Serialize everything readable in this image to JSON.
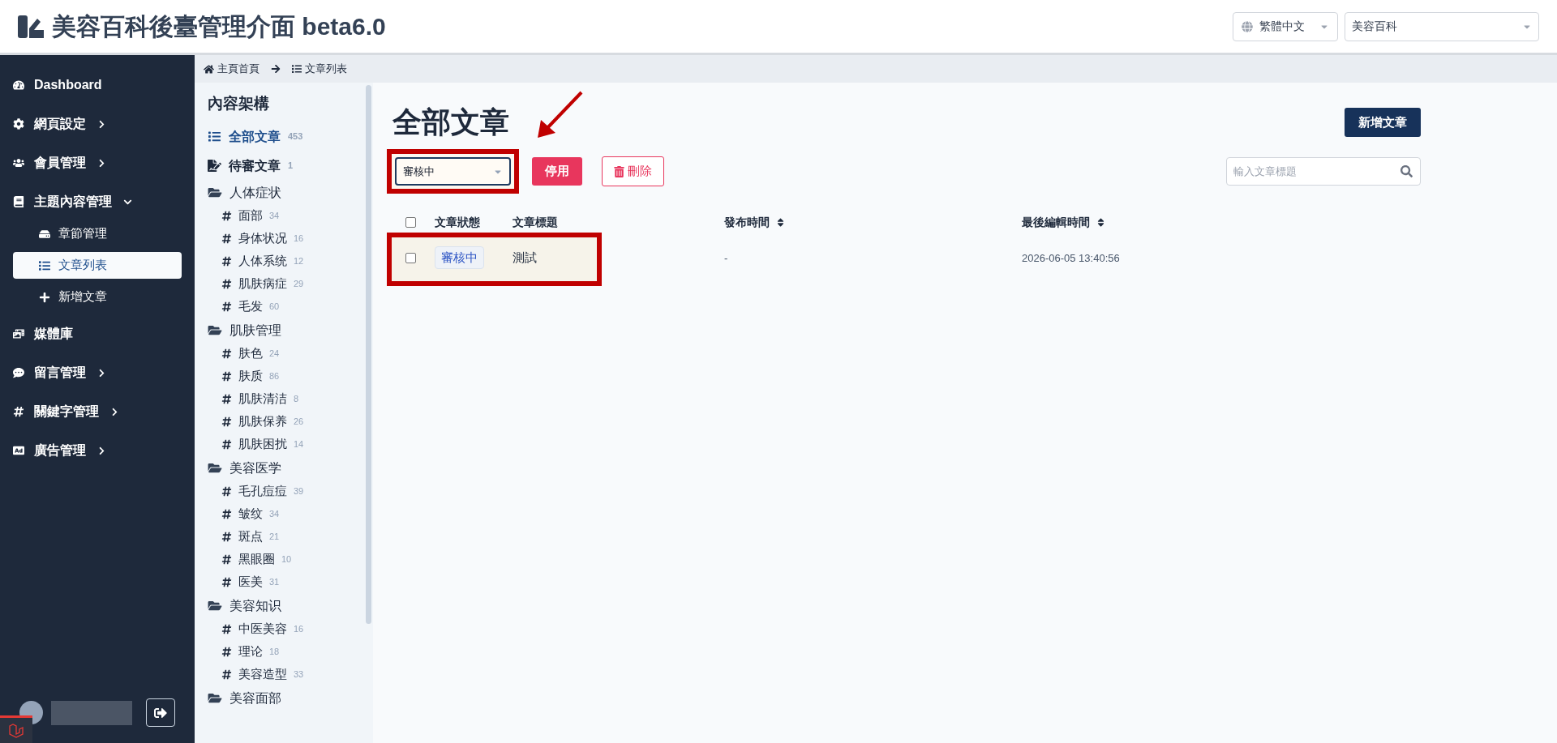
{
  "header": {
    "title": "美容百科後臺管理介面 beta6.0",
    "language_select": {
      "value": "繁體中文"
    },
    "site_select": {
      "value": "美容百科"
    }
  },
  "sidebar": {
    "items": [
      {
        "label": "Dashboard"
      },
      {
        "label": "網頁設定",
        "expanded": false
      },
      {
        "label": "會員管理",
        "expanded": false
      },
      {
        "label": "主題內容管理",
        "expanded": true,
        "children": [
          {
            "label": "章節管理",
            "selected": false
          },
          {
            "label": "文章列表",
            "selected": true
          },
          {
            "label": "新增文章",
            "selected": false
          }
        ]
      },
      {
        "label": "媒體庫"
      },
      {
        "label": "留言管理",
        "expanded": false
      },
      {
        "label": "關鍵字管理",
        "expanded": false
      },
      {
        "label": "廣告管理",
        "expanded": false
      }
    ]
  },
  "breadcrumb": [
    "主頁首頁",
    "文章列表"
  ],
  "tree": {
    "title": "內容架構",
    "items": [
      {
        "kind": "list",
        "label": "全部文章",
        "count": "453",
        "selected": true
      },
      {
        "kind": "pending",
        "label": "待審文章",
        "count": "1",
        "selected": false
      },
      {
        "kind": "folder",
        "label": "人体症状",
        "children": [
          {
            "label": "面部",
            "count": "34"
          },
          {
            "label": "身体状况",
            "count": "16"
          },
          {
            "label": "人体系统",
            "count": "12"
          },
          {
            "label": "肌肤病症",
            "count": "29"
          },
          {
            "label": "毛发",
            "count": "60"
          }
        ]
      },
      {
        "kind": "folder",
        "label": "肌肤管理",
        "children": [
          {
            "label": "肤色",
            "count": "24"
          },
          {
            "label": "肤质",
            "count": "86"
          },
          {
            "label": "肌肤清洁",
            "count": "8"
          },
          {
            "label": "肌肤保养",
            "count": "26"
          },
          {
            "label": "肌肤困扰",
            "count": "14"
          }
        ]
      },
      {
        "kind": "folder",
        "label": "美容医学",
        "children": [
          {
            "label": "毛孔痘痘",
            "count": "39"
          },
          {
            "label": "皱纹",
            "count": "34"
          },
          {
            "label": "斑点",
            "count": "21"
          },
          {
            "label": "黑眼圈",
            "count": "10"
          },
          {
            "label": "医美",
            "count": "31"
          }
        ]
      },
      {
        "kind": "folder",
        "label": "美容知识",
        "children": [
          {
            "label": "中医美容",
            "count": "16"
          },
          {
            "label": "理论",
            "count": "18"
          },
          {
            "label": "美容造型",
            "count": "33"
          }
        ]
      },
      {
        "kind": "folder",
        "label": "美容面部"
      }
    ]
  },
  "main": {
    "title": "全部文章",
    "new_button": "新增文章",
    "status_filter": {
      "value": "審核中"
    },
    "disable_button": "停用",
    "delete_button": "刪除",
    "search": {
      "placeholder": "輸入文章標題"
    },
    "table": {
      "all_checked": false,
      "columns": [
        {
          "label": "文章狀態",
          "sortable": false
        },
        {
          "label": "文章標題",
          "sortable": false
        },
        {
          "label": "發布時間",
          "sortable": true
        },
        {
          "label": "最後編輯時間",
          "sortable": true
        }
      ],
      "rows": [
        {
          "checked": false,
          "status": "審核中",
          "title": "測試",
          "published": "-",
          "edited": "2026-06-05 13:40:56"
        }
      ]
    }
  }
}
